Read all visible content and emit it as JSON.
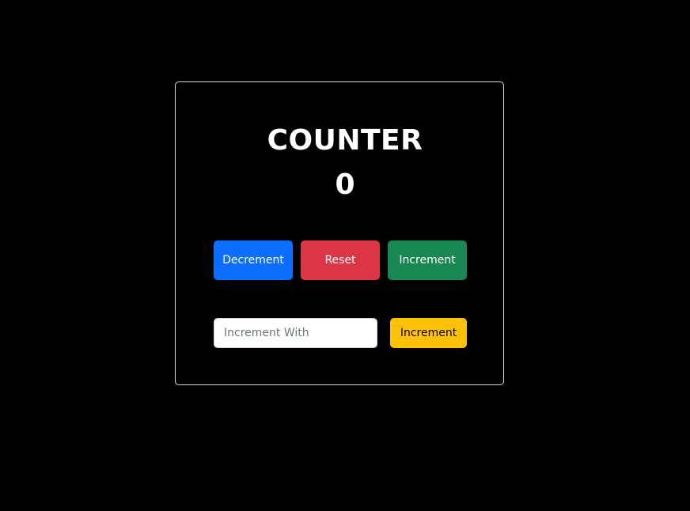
{
  "counter": {
    "title": "COUNTER",
    "value": "0"
  },
  "buttons": {
    "decrement_label": "Decrement",
    "reset_label": "Reset",
    "increment_label": "Increment"
  },
  "increment_with": {
    "placeholder": "Increment With",
    "value": "",
    "button_label": "Increment"
  },
  "colors": {
    "background": "#000000",
    "card_border": "#d9d9d9",
    "decrement": "#0d6efd",
    "reset": "#dc3545",
    "increment": "#198754",
    "increment_with": "#ffc107"
  }
}
